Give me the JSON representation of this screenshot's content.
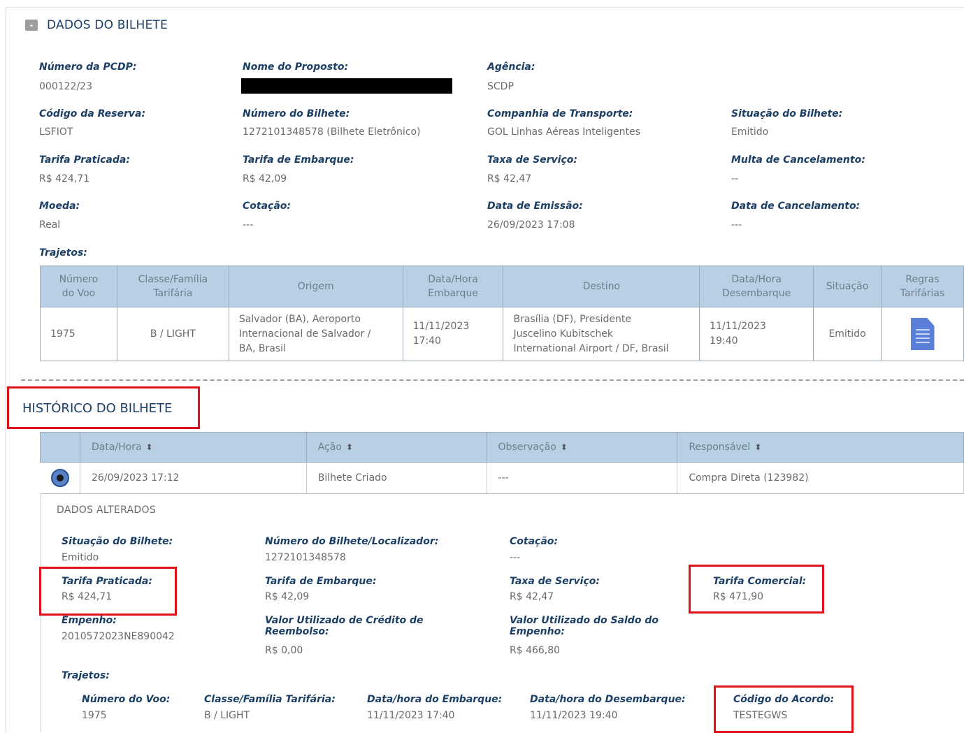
{
  "section": {
    "toggle": "-",
    "title": "DADOS DO BILHETE"
  },
  "fields": {
    "numero_pcdp": {
      "label": "Número da PCDP:",
      "value": "000122/23"
    },
    "nome_proposto": {
      "label": "Nome do Proposto:"
    },
    "agencia": {
      "label": "Agência:",
      "value": "SCDP"
    },
    "codigo_reserva": {
      "label": "Código da Reserva:",
      "value": "LSFIOT"
    },
    "numero_bilhete": {
      "label": "Número do Bilhete:",
      "value": "1272101348578 (Bilhete Eletrônico)"
    },
    "companhia": {
      "label": "Companhia de Transporte:",
      "value": "GOL Linhas Aéreas Inteligentes"
    },
    "situacao": {
      "label": "Situação do Bilhete:",
      "value": "Emitido"
    },
    "tarifa_praticada": {
      "label": "Tarifa Praticada:",
      "value": "R$ 424,71"
    },
    "tarifa_embarque": {
      "label": "Tarifa de Embarque:",
      "value": "R$ 42,09"
    },
    "taxa_servico": {
      "label": "Taxa de Serviço:",
      "value": "R$ 42,47"
    },
    "multa_cancelamento": {
      "label": "Multa de Cancelamento:",
      "value": "--"
    },
    "moeda": {
      "label": "Moeda:",
      "value": "Real"
    },
    "cotacao": {
      "label": "Cotação:",
      "value": "---"
    },
    "data_emissao": {
      "label": "Data de Emissão:",
      "value": "26/09/2023 17:08"
    },
    "data_cancelamento": {
      "label": "Data de Cancelamento:",
      "value": "---"
    },
    "trajetos_label": "Trajetos:"
  },
  "trajetos_table": {
    "headers": {
      "numero_voo": [
        "Número",
        "do Voo"
      ],
      "classe": [
        "Classe/Família",
        "Tarifária"
      ],
      "origem": "Origem",
      "embarque": [
        "Data/Hora",
        "Embarque"
      ],
      "destino": "Destino",
      "desembarque": [
        "Data/Hora",
        "Desembarque"
      ],
      "situacao": "Situação",
      "regras": [
        "Regras",
        "Tarifárias"
      ]
    },
    "row": {
      "numero_voo": "1975",
      "classe": "B / LIGHT",
      "origem": [
        "Salvador (BA), Aeroporto",
        "Internacional de Salvador /",
        "BA, Brasil"
      ],
      "embarque": [
        "11/11/2023",
        "17:40"
      ],
      "destino": [
        "Brasília (DF), Presidente",
        "Juscelino Kubitschek",
        "International Airport / DF, Brasil"
      ],
      "desembarque": [
        "11/11/2023",
        "19:40"
      ],
      "situacao": "Emitido",
      "regras_icon": "document-icon"
    }
  },
  "historico": {
    "title": "HISTÓRICO DO BILHETE",
    "headers": {
      "data_hora": "Data/Hora",
      "acao": "Ação",
      "observacao": "Observação",
      "responsavel": "Responsável"
    },
    "sort_icon": "sort-icon",
    "row": {
      "data_hora": "26/09/2023 17:12",
      "acao": "Bilhete Criado",
      "observacao": "---",
      "responsavel": "Compra Direta (123982)"
    },
    "dados_alterados": {
      "title": "DADOS ALTERADOS",
      "situacao": {
        "label": "Situação do Bilhete:",
        "value": "Emitido"
      },
      "numero_localizador": {
        "label": "Número do Bilhete/Localizador:",
        "value": "1272101348578"
      },
      "cotacao": {
        "label": "Cotação:",
        "value": "---"
      },
      "tarifa_praticada": {
        "label": "Tarifa Praticada:",
        "value": "R$ 424,71"
      },
      "tarifa_embarque": {
        "label": "Tarifa de Embarque:",
        "value": "R$ 42,09"
      },
      "taxa_servico": {
        "label": "Taxa de Serviço:",
        "value": "R$ 42,47"
      },
      "tarifa_comercial": {
        "label": "Tarifa Comercial:",
        "value": "R$ 471,90"
      },
      "empenho": {
        "label": "Empenho:",
        "value": "2010572023NE890042"
      },
      "credito_reembolso": {
        "label": [
          "Valor Utilizado de Crédito de",
          "Reembolso:"
        ],
        "value": "R$ 0,00"
      },
      "saldo_empenho": {
        "label": [
          "Valor Utilizado do Saldo do",
          "Empenho:"
        ],
        "value": "R$ 466,80"
      },
      "trajetos_label": "Trajetos:",
      "trajeto": {
        "numero_voo": {
          "label": "Número do Voo:",
          "value": "1975"
        },
        "classe": {
          "label": "Classe/Família Tarifária:",
          "value": "B / LIGHT"
        },
        "embarque": {
          "label": "Data/hora do Embarque:",
          "value": "11/11/2023 17:40"
        },
        "desembarque": {
          "label": "Data/hora do Desembarque:",
          "value": "11/11/2023 19:40"
        },
        "codigo_acordo": {
          "label": "Código do Acordo:",
          "value": "TESTEGWS"
        }
      }
    }
  }
}
